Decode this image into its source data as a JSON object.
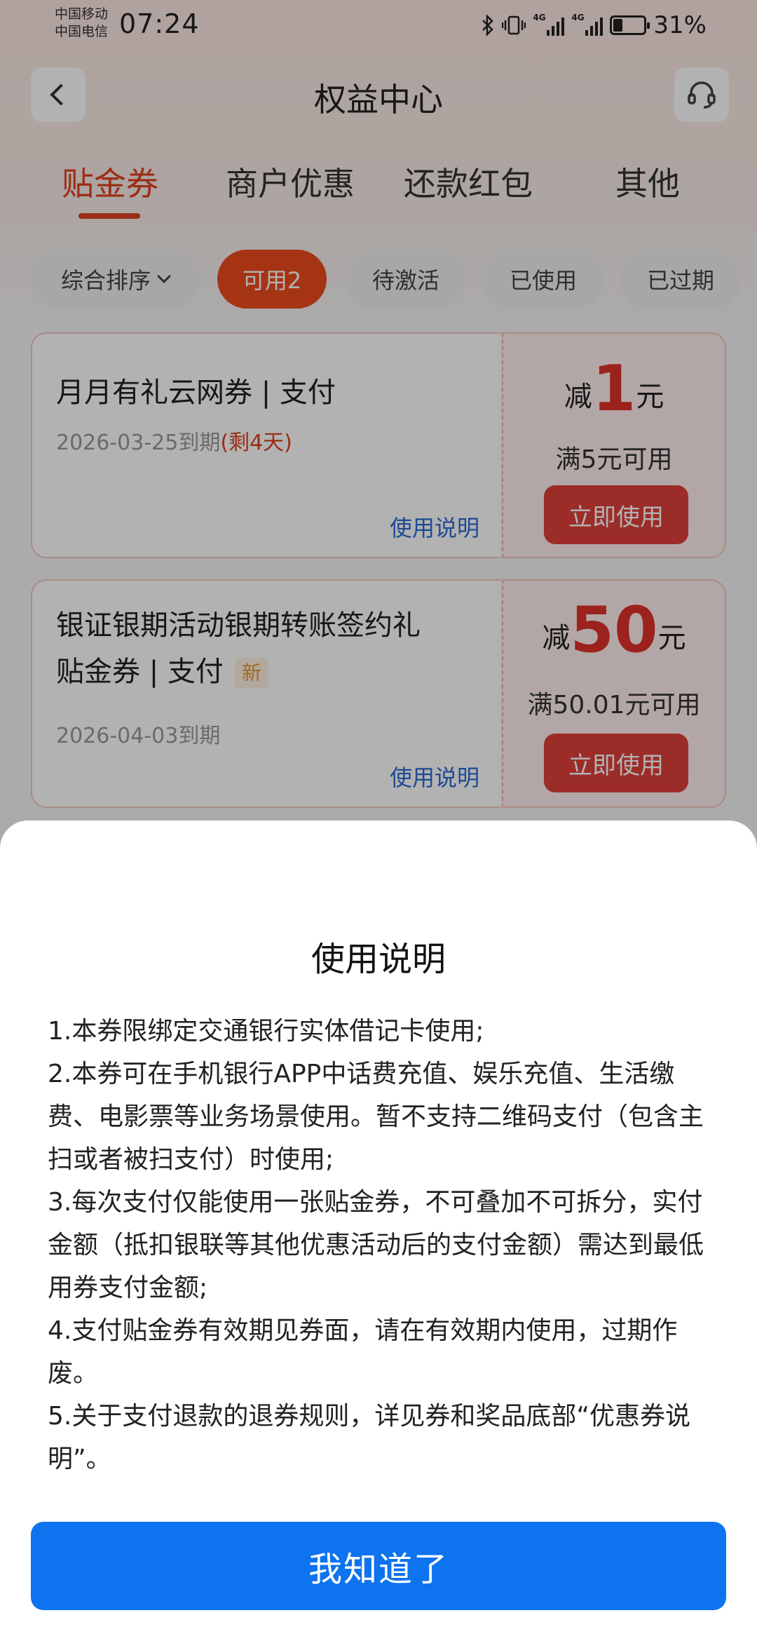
{
  "status_bar": {
    "carrier_1": "中国移动",
    "carrier_2": "中国电信",
    "time": "07:24",
    "network_1": "4G",
    "network_2": "4G",
    "battery_pct": "31%",
    "battery_level": 0.31
  },
  "header": {
    "title": "权益中心"
  },
  "tabs": [
    {
      "label": "贴金券",
      "active": true
    },
    {
      "label": "商户优惠",
      "active": false
    },
    {
      "label": "还款红包",
      "active": false
    },
    {
      "label": "其他",
      "active": false
    }
  ],
  "filters": {
    "sort_label": "综合排序",
    "chips": [
      {
        "label": "可用2",
        "active": true
      },
      {
        "label": "待激活",
        "active": false
      },
      {
        "label": "已使用",
        "active": false
      },
      {
        "label": "已过期",
        "active": false
      }
    ]
  },
  "coupons": [
    {
      "title_line1": "月月有礼云网券 | 支付",
      "title_line2": "",
      "badge": "",
      "expiry": "2026-03-25到期",
      "remaining": "(剩4天)",
      "help_label": "使用说明",
      "amount_prefix": "减",
      "amount": "1",
      "amount_suffix": "元",
      "condition": "满5元可用",
      "use_label": "立即使用"
    },
    {
      "title_line1": "银证银期活动银期转账签约礼",
      "title_line2": "贴金券 | 支付",
      "badge": "新",
      "expiry": "2026-04-03到期",
      "remaining": "",
      "help_label": "使用说明",
      "amount_prefix": "减",
      "amount": "50",
      "amount_suffix": "元",
      "condition": "满50.01元可用",
      "use_label": "立即使用"
    }
  ],
  "sheet": {
    "title": "使用说明",
    "lines": [
      "1.本券限绑定交通银行实体借记卡使用;",
      "2.本券可在手机银行APP中话费充值、娱乐充值、生活缴费、电影票等业务场景使用。暂不支持二维码支付（包含主扫或者被扫支付）时使用;",
      "3.每次支付仅能使用一张贴金券，不可叠加不可拆分，实付金额（抵扣银联等其他优惠活动后的支付金额）需达到最低用券支付金额;",
      "4.支付贴金券有效期见券面，请在有效期内使用，过期作废。",
      "5.关于支付退款的退券规则，详见券和奖品底部“优惠券说明”。"
    ],
    "confirm_label": "我知道了"
  },
  "colors": {
    "accent": "#e0401e",
    "chip_active": "#ec4b1f",
    "use_button": "#e0403a",
    "amount": "#e0322a",
    "link": "#2a6bd4",
    "confirm_button": "#0d73ee"
  }
}
